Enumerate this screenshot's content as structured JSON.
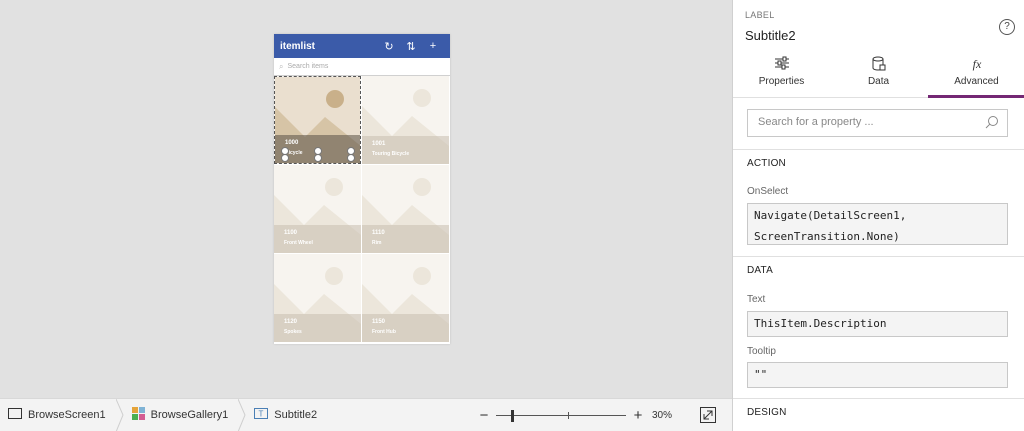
{
  "app": {
    "title": "itemlist",
    "search_placeholder": "Search items",
    "tiles": [
      {
        "number": "1000",
        "description": "Bicycle"
      },
      {
        "number": "1001",
        "description": "Touring Bicycle"
      },
      {
        "number": "1100",
        "description": "Front Wheel"
      },
      {
        "number": "1110",
        "description": "Rim"
      },
      {
        "number": "1120",
        "description": "Spokes"
      },
      {
        "number": "1150",
        "description": "Front Hub"
      }
    ]
  },
  "breadcrumb": {
    "screen": "BrowseScreen1",
    "gallery": "BrowseGallery1",
    "control": "Subtitle2"
  },
  "zoom": {
    "minus": "−",
    "plus": "+",
    "level": "30%",
    "level_value": 0.3
  },
  "panel": {
    "control_type": "LABEL",
    "control_name": "Subtitle2",
    "help": "?",
    "tabs": [
      {
        "label": "Properties",
        "icon": "sliders-icon"
      },
      {
        "label": "Data",
        "icon": "database-icon"
      },
      {
        "label": "Advanced",
        "icon": "fx-icon",
        "active": true
      }
    ],
    "search_placeholder": "Search for a property ...",
    "sections": {
      "action": "ACTION",
      "data": "DATA",
      "design": "DESIGN"
    },
    "properties": {
      "onselect_label": "OnSelect",
      "onselect_value": "Navigate(DetailScreen1,\nScreenTransition.None)",
      "text_label": "Text",
      "text_value": "ThisItem.Description",
      "tooltip_label": "Tooltip",
      "tooltip_value": "\"\""
    }
  },
  "colors": {
    "app_header": "#3b5ba9",
    "active_tab": "#742774"
  }
}
